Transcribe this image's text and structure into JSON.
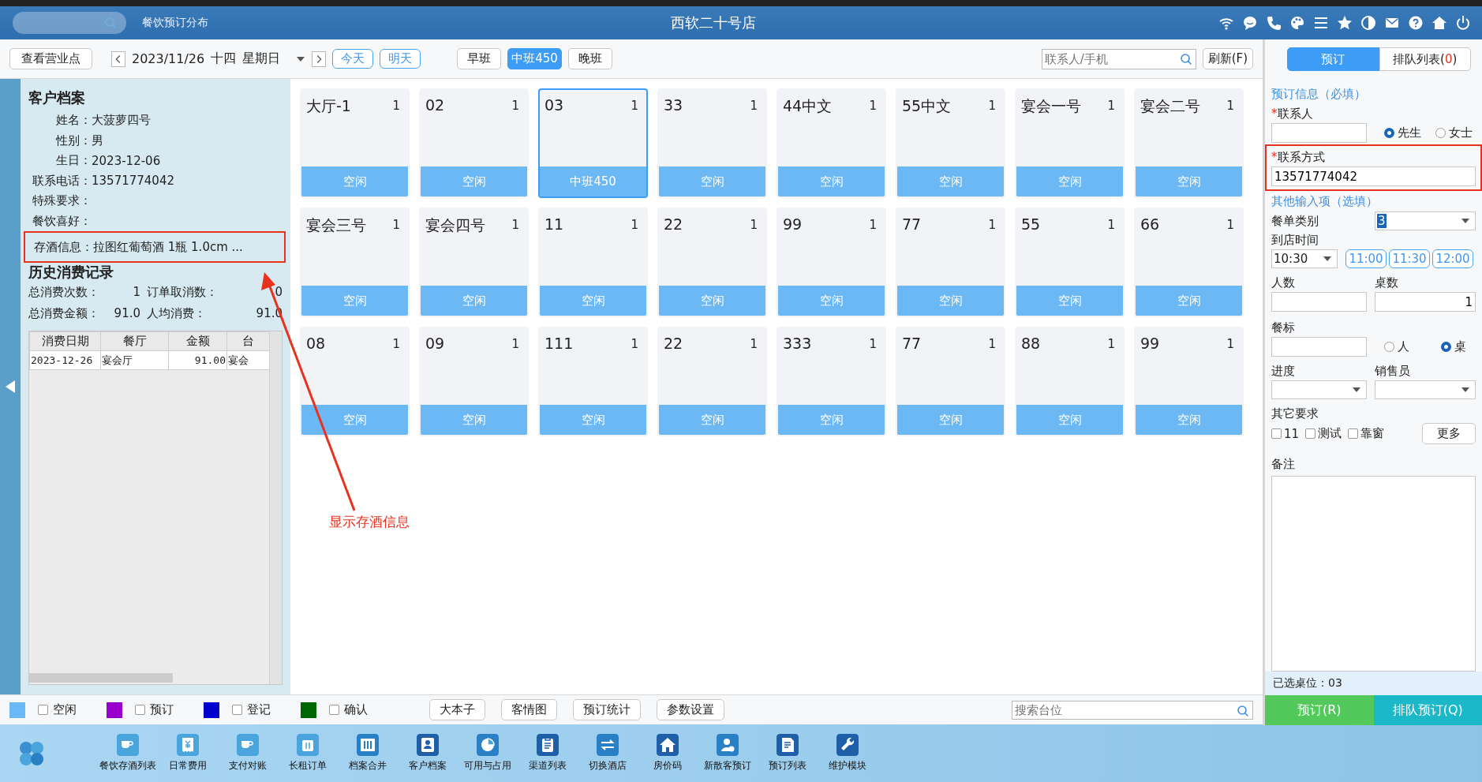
{
  "title_bar": {
    "module": "餐饮预订分布",
    "store": "西软二十号店"
  },
  "toolbar": {
    "outlet_button": "查看营业点",
    "date": "2023/11/26",
    "lunar_day": "十四",
    "weekday": "星期日",
    "day_buttons": [
      "今天",
      "明天"
    ],
    "shifts": [
      {
        "label": "早班",
        "selected": false
      },
      {
        "label": "中班450",
        "selected": true
      },
      {
        "label": "晚班",
        "selected": false
      }
    ],
    "search_placeholder": "联系人/手机",
    "refresh_button": "刷新(F)"
  },
  "customer": {
    "title": "客户档案",
    "fields": [
      {
        "label": "姓名：",
        "value": "大菠萝四号",
        "highlighted": false
      },
      {
        "label": "性别：",
        "value": "男",
        "highlighted": false
      },
      {
        "label": "生日：",
        "value": "2023-12-06",
        "highlighted": false
      },
      {
        "label": "联系电话：",
        "value": "13571774042",
        "highlighted": false
      },
      {
        "label": "特殊要求：",
        "highlighted": false
      },
      {
        "label": "餐饮喜好：",
        "highlighted": false
      },
      {
        "label": "存酒信息：",
        "value": "拉图红葡萄酒 1瓶 1.0cm ...",
        "highlighted": true
      }
    ],
    "history_title": "历史消费记录",
    "stats": [
      {
        "label": "总消费次数：",
        "value": "1"
      },
      {
        "label": "订单取消数：",
        "value": "0"
      },
      {
        "label": "总消费金额：",
        "value": "91.0"
      },
      {
        "label": "人均消费：",
        "value": "91.0"
      }
    ],
    "history_table": {
      "columns": [
        "消费日期",
        "餐厅",
        "金额",
        "台"
      ],
      "rows": [
        [
          "2023-12-26",
          "宴会厅",
          "91.00",
          "宴会"
        ]
      ]
    }
  },
  "tables": [
    {
      "name": "大厅-1",
      "count": "1",
      "status": "空闲",
      "selected": false
    },
    {
      "name": "02",
      "count": "1",
      "status": "空闲",
      "selected": false
    },
    {
      "name": "03",
      "count": "1",
      "status": "中班450",
      "selected": true
    },
    {
      "name": "33",
      "count": "1",
      "status": "空闲",
      "selected": false
    },
    {
      "name": "44中文",
      "count": "1",
      "status": "空闲",
      "selected": false
    },
    {
      "name": "55中文",
      "count": "1",
      "status": "空闲",
      "selected": false
    },
    {
      "name": "宴会一号",
      "count": "1",
      "status": "空闲",
      "selected": false
    },
    {
      "name": "宴会二号",
      "count": "1",
      "status": "空闲",
      "selected": false
    },
    {
      "name": "宴会三号",
      "count": "1",
      "status": "空闲",
      "selected": false
    },
    {
      "name": "宴会四号",
      "count": "1",
      "status": "空闲",
      "selected": false
    },
    {
      "name": "11",
      "count": "1",
      "status": "空闲",
      "selected": false
    },
    {
      "name": "22",
      "count": "1",
      "status": "空闲",
      "selected": false
    },
    {
      "name": "99",
      "count": "1",
      "status": "空闲",
      "selected": false
    },
    {
      "name": "77",
      "count": "1",
      "status": "空闲",
      "selected": false
    },
    {
      "name": "55",
      "count": "1",
      "status": "空闲",
      "selected": false
    },
    {
      "name": "66",
      "count": "1",
      "status": "空闲",
      "selected": false
    },
    {
      "name": "08",
      "count": "1",
      "status": "空闲",
      "selected": false
    },
    {
      "name": "09",
      "count": "1",
      "status": "空闲",
      "selected": false
    },
    {
      "name": "111",
      "count": "1",
      "status": "空闲",
      "selected": false
    },
    {
      "name": "22",
      "count": "1",
      "status": "空闲",
      "selected": false
    },
    {
      "name": "333",
      "count": "1",
      "status": "空闲",
      "selected": false
    },
    {
      "name": "77",
      "count": "1",
      "status": "空闲",
      "selected": false
    },
    {
      "name": "88",
      "count": "1",
      "status": "空闲",
      "selected": false
    },
    {
      "name": "99",
      "count": "1",
      "status": "空闲",
      "selected": false
    }
  ],
  "annotation": {
    "text": "显示存酒信息"
  },
  "legend": {
    "items": [
      {
        "label": "空闲",
        "color": "#6cb8f5",
        "checked": false
      },
      {
        "label": "预订",
        "color": "#9900cc",
        "checked": false
      },
      {
        "label": "登记",
        "color": "#0000cc",
        "checked": false
      },
      {
        "label": "确认",
        "color": "#006600",
        "checked": false
      }
    ],
    "buttons": [
      "大本子",
      "客情图",
      "预订统计",
      "参数设置"
    ],
    "search_placeholder": "搜索台位"
  },
  "booking": {
    "tabs": [
      {
        "label": "预订",
        "selected": true
      },
      {
        "label": "排队列表(",
        "count": "0",
        "label_end": ")",
        "selected": false
      }
    ],
    "required_title": "预订信息（必填）",
    "contact": {
      "mark": "*",
      "label": "联系人",
      "titles": [
        {
          "label": "先生",
          "selected": true
        },
        {
          "label": "女士",
          "selected": false
        }
      ]
    },
    "contact_method": {
      "mark": "*",
      "label": "联系方式",
      "value": "13571774042",
      "highlighted": true
    },
    "optional_title": "其他输入项（选填）",
    "menu_type": {
      "label": "餐单类别",
      "value": "3"
    },
    "arrival": {
      "label": "到店时间",
      "value": "10:30",
      "quick_times": [
        "11:00",
        "11:30",
        "12:00"
      ]
    },
    "guests": {
      "label": "人数"
    },
    "table_count": {
      "label": "桌数",
      "value": "1"
    },
    "price_standard": {
      "label": "餐标",
      "units": [
        {
          "label": "人",
          "selected": false
        },
        {
          "label": "桌",
          "selected": true
        }
      ]
    },
    "progress": {
      "label": "进度"
    },
    "salesperson": {
      "label": "销售员"
    },
    "other_requests": {
      "label": "其它要求",
      "options": [
        {
          "label": "11",
          "checked": false
        },
        {
          "label": "测试",
          "checked": false
        },
        {
          "label": "靠窗",
          "checked": false
        }
      ],
      "more_button": "更多"
    },
    "remarks": {
      "label": "备注"
    },
    "selected_tables": "已选桌位：03",
    "actions": [
      "预订(R)",
      "排队预订(Q)"
    ]
  },
  "dock": {
    "items": [
      "餐饮存酒列表",
      "日常费用",
      "支付对账",
      "长租订单",
      "档案合并",
      "客户档案",
      "可用与占用",
      "渠道列表",
      "切换酒店",
      "房价码",
      "新散客预订",
      "预订列表",
      "维护模块"
    ]
  }
}
